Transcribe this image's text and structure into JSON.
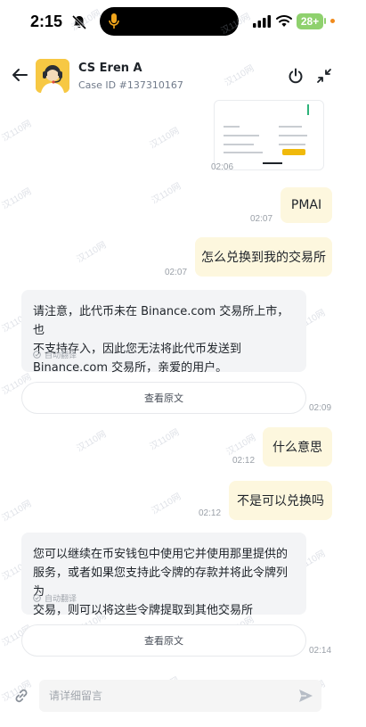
{
  "status_bar": {
    "time": "2:15",
    "battery": "28+"
  },
  "header": {
    "agent_name": "CS Eren A",
    "case_id": "Case ID #137310167"
  },
  "watermark": "汉110网",
  "messages": [
    {
      "from": "agent",
      "type": "image",
      "time": "02:06"
    },
    {
      "from": "user",
      "text": "PMAI",
      "time": "02:07"
    },
    {
      "from": "user",
      "text": "怎么兑换到我的交易所",
      "time": "02:07"
    },
    {
      "from": "agent",
      "lines": [
        "请注意，此代币未在 Binance.com 交易所上市，也",
        "不支持存入，因此您无法将此代币发送到",
        "Binance.com 交易所，亲爱的用户。"
      ],
      "translated_label": "自动翻译",
      "view_original": "查看原文",
      "time": "02:09"
    },
    {
      "from": "user",
      "text": "什么意思",
      "time": "02:12"
    },
    {
      "from": "user",
      "text": "不是可以兑换吗",
      "time": "02:12"
    },
    {
      "from": "agent",
      "lines": [
        "您可以继续在币安钱包中使用它并使用那里提供的",
        "服务，或者如果您支持此令牌的存款并将此令牌列为",
        "交易，则可以将这些令牌提取到其他交易所"
      ],
      "translated_label": "自动翻译",
      "view_original": "查看原文",
      "time": "02:14"
    }
  ],
  "composer": {
    "placeholder": "请详细留言"
  },
  "colors": {
    "accent_yellow": "#f0b90b",
    "user_bubble": "#fdf7de",
    "agent_bubble": "#f3f4f6"
  }
}
